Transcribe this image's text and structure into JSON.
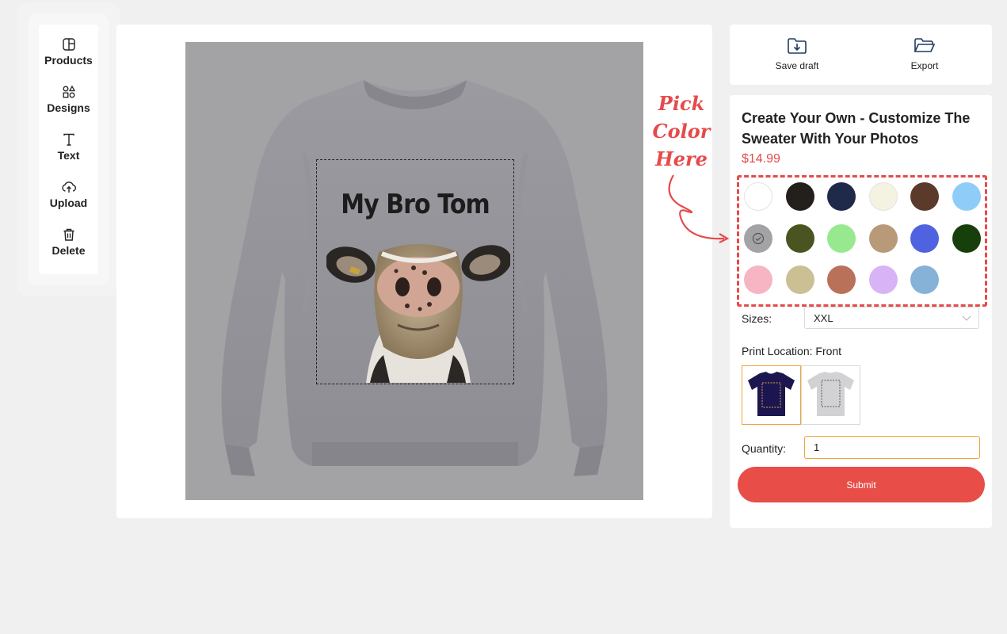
{
  "toolbar": {
    "items": [
      {
        "label": "Products",
        "icon": "products-icon"
      },
      {
        "label": "Designs",
        "icon": "designs-icon"
      },
      {
        "label": "Text",
        "icon": "text-icon"
      },
      {
        "label": "Upload",
        "icon": "upload-icon"
      },
      {
        "label": "Delete",
        "icon": "delete-icon"
      }
    ]
  },
  "canvas": {
    "design_text": "My Bro Tom",
    "product": "sweater",
    "design_image": "cow-face-photo"
  },
  "actions": {
    "save_label": "Save draft",
    "export_label": "Export"
  },
  "product": {
    "title": "Create Your Own - Customize The Sweater With Your Photos",
    "price": "$14.99"
  },
  "annotation": {
    "text_line1": "Pick",
    "text_line2": "Color",
    "text_line3": "Here"
  },
  "colors": [
    "#ffffff",
    "#231f1b",
    "#1f2a4a",
    "#f4f3e2",
    "#5b3a2b",
    "#8fccf8",
    "#a3a3a5",
    "#4a5420",
    "#98e88f",
    "#b89a78",
    "#4f63e0",
    "#163f0c",
    "#f7b5c3",
    "#cbbf94",
    "#b9715a",
    "#d8b3f5",
    "#86b2d8"
  ],
  "selected_color": "#a3a3a5",
  "sizes": {
    "label": "Sizes:",
    "value": "XXL"
  },
  "print_location": {
    "label": "Print Location: Front",
    "options": [
      "front",
      "back"
    ],
    "selected": "front"
  },
  "quantity": {
    "label": "Quantity:",
    "value": "1"
  },
  "submit_label": "Submit"
}
